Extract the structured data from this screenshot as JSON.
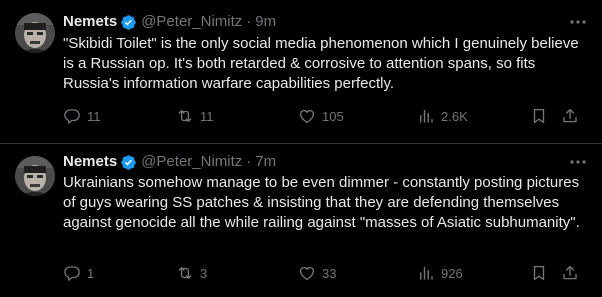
{
  "tweets": [
    {
      "display_name": "Nemets",
      "handle": "@Peter_Nimitz",
      "separator": "·",
      "time": "9m",
      "text": "\"Skibidi Toilet\" is the only social media phenomenon which I genuinely believe is a Russian op. It's both retarded & corrosive to attention spans, so fits Russia's information warfare capabilities perfectly.",
      "reply_count": "11",
      "repost_count": "11",
      "like_count": "105",
      "view_count": "2.6K"
    },
    {
      "display_name": "Nemets",
      "handle": "@Peter_Nimitz",
      "separator": "·",
      "time": "7m",
      "text": "Ukrainians somehow manage to be even dimmer - constantly posting pictures of guys wearing SS patches & insisting that they are defending themselves against genocide all the while railing against \"masses of Asiatic subhumanity\".",
      "reply_count": "1",
      "repost_count": "3",
      "like_count": "33",
      "view_count": "926"
    }
  ],
  "icons": {
    "verified": "verified-badge-icon",
    "more": "more-dots-icon",
    "reply": "reply-icon",
    "repost": "repost-icon",
    "like": "like-heart-icon",
    "views": "views-chart-icon",
    "bookmark": "bookmark-icon",
    "share": "share-icon"
  },
  "colors": {
    "background": "#000000",
    "text_primary": "#e7e9ea",
    "text_secondary": "#71767b",
    "verified_blue": "#1d9bf0",
    "divider": "#2f3336"
  }
}
